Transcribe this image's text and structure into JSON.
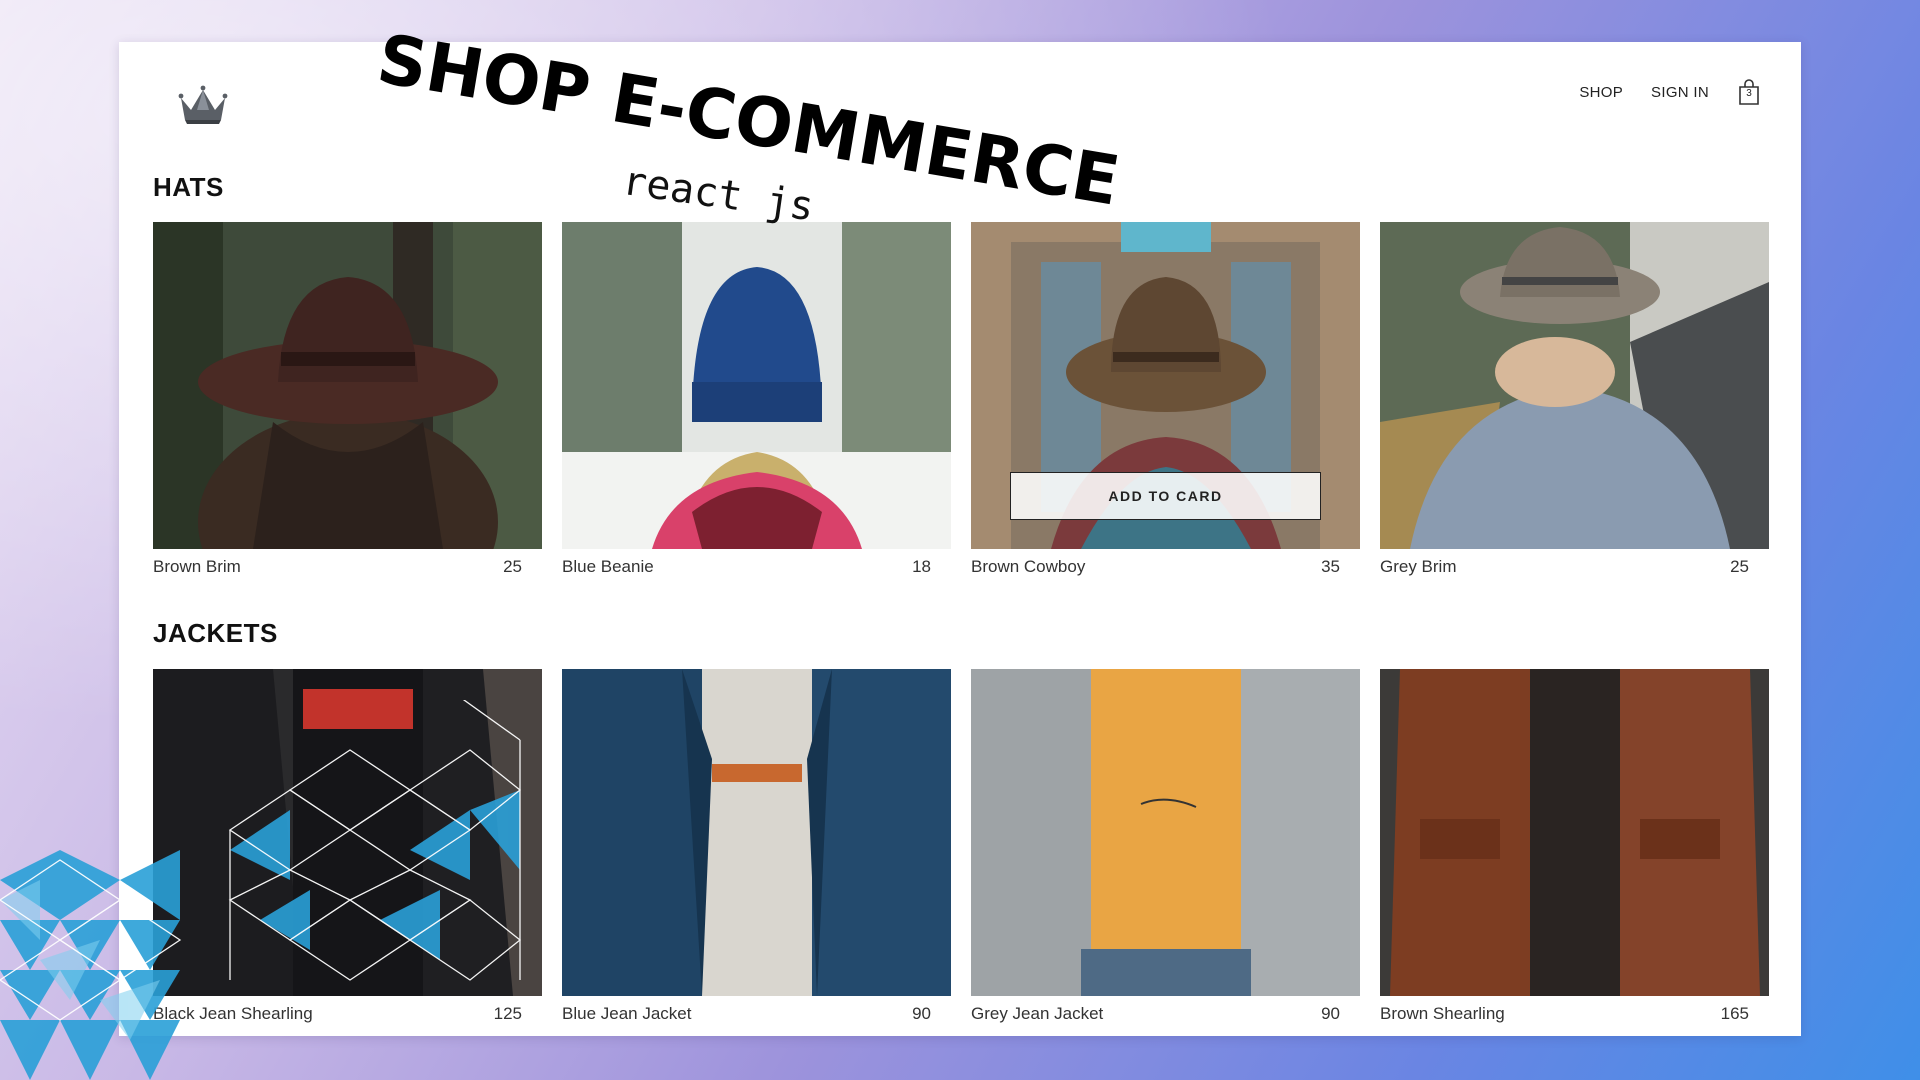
{
  "overlay": {
    "title": "SHOP E-COMMERCE",
    "subtitle": "react js"
  },
  "header": {
    "logo_icon": "crown-icon",
    "nav": [
      {
        "label": "SHOP"
      },
      {
        "label": "SIGN IN"
      }
    ],
    "cart": {
      "icon": "shopping-bag-icon",
      "count": "3"
    }
  },
  "sections": [
    {
      "title": "HATS",
      "items": [
        {
          "name": "Brown Brim",
          "price": "25"
        },
        {
          "name": "Blue Beanie",
          "price": "18"
        },
        {
          "name": "Brown Cowboy",
          "price": "35",
          "button": "ADD TO CARD"
        },
        {
          "name": "Grey Brim",
          "price": "25"
        }
      ]
    },
    {
      "title": "JACKETS",
      "items": [
        {
          "name": "Black Jean Shearling",
          "price": "125"
        },
        {
          "name": "Blue Jean Jacket",
          "price": "90"
        },
        {
          "name": "Grey Jean Jacket",
          "price": "90"
        },
        {
          "name": "Brown Shearling",
          "price": "165"
        }
      ]
    }
  ],
  "colors": {
    "page_bg": "#ffffff",
    "text": "#222222",
    "background_gradient_start": "#e8def3",
    "background_gradient_end": "#3f8fe8",
    "decor_accent": "#2a9fd6"
  }
}
